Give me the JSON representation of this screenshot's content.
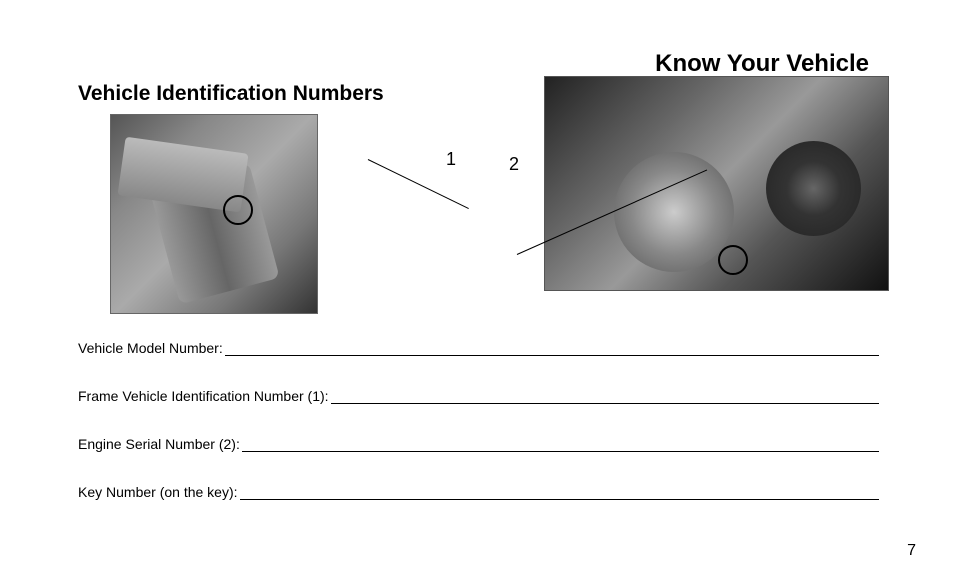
{
  "header": {
    "main_title": "Know Your Vehicle",
    "section_title": "Vehicle Identification Numbers"
  },
  "callouts": {
    "label_1": "1",
    "label_2": "2"
  },
  "form": {
    "fields": [
      {
        "label": "Vehicle Model Number:"
      },
      {
        "label": "Frame Vehicle Identification Number (1):"
      },
      {
        "label": "Engine Serial Number (2):"
      },
      {
        "label": "Key Number (on the key):"
      }
    ]
  },
  "page_number": "7"
}
